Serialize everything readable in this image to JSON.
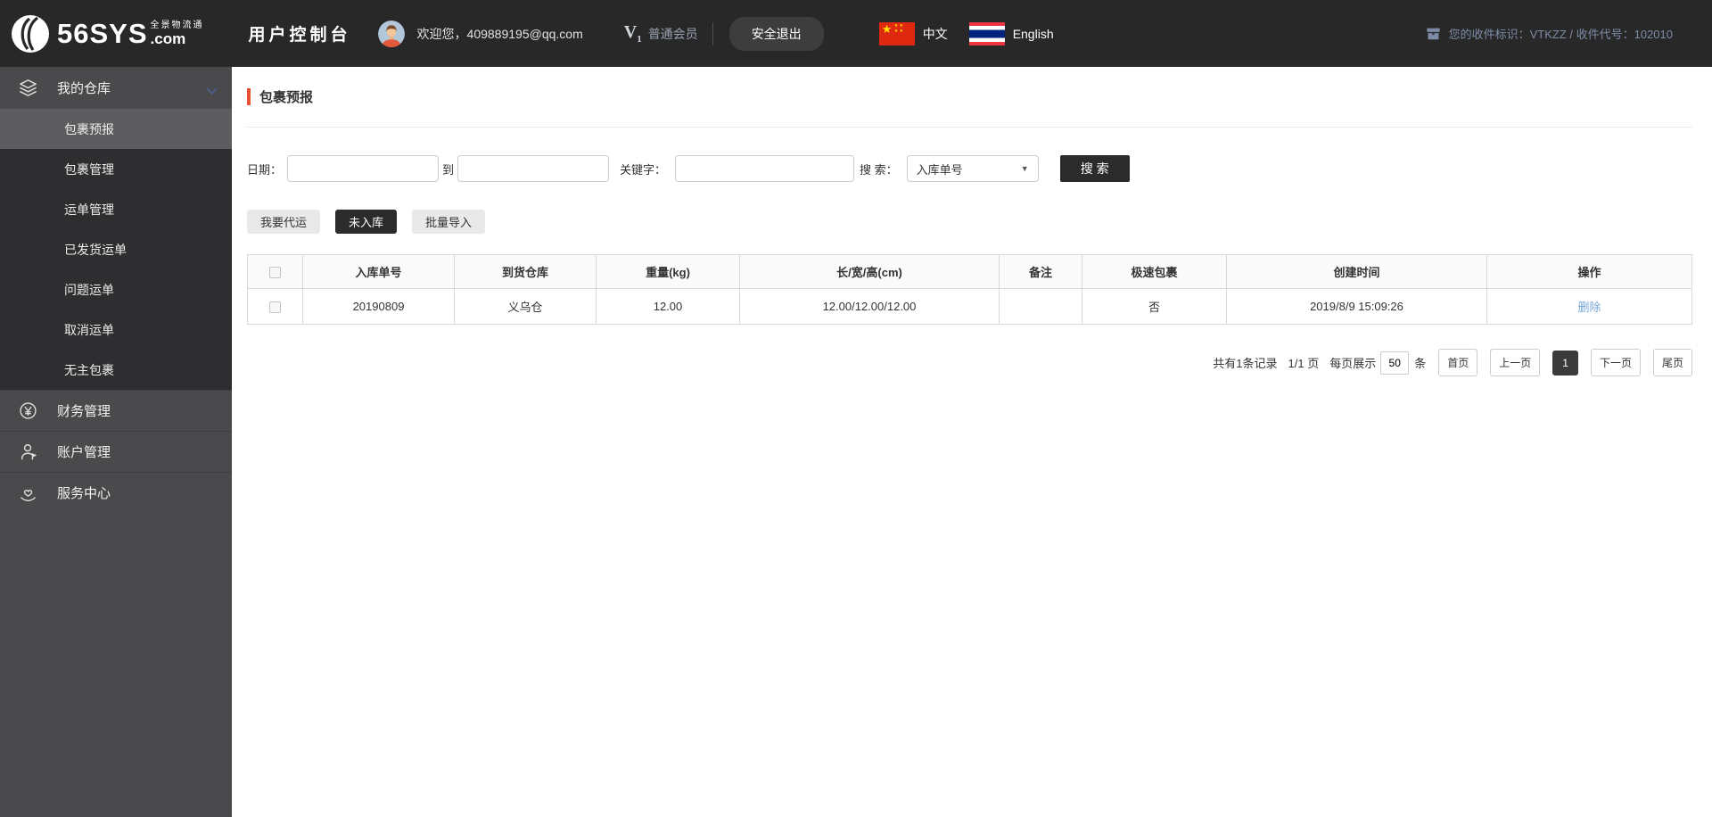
{
  "theme": {
    "header_bg": "#282828",
    "sidebar_bg": "#4a4a4c",
    "accent": "#e8502e",
    "dark_button": "#2b2b2b",
    "link_blue": "#74a7d8",
    "slate_info": "#7e8ca8"
  },
  "header": {
    "brand": "56SYS",
    "brand_domain": ".com",
    "brand_slogan": "全景物流通",
    "console_title": "用户控制台",
    "welcome_text": "欢迎您，409889195@qq.com",
    "member_level": "V",
    "member_level_sub": "1",
    "member_label": "普通会员",
    "logout_label": "安全退出",
    "lang_zh": "中文",
    "lang_en": "English",
    "receiver_info": "您的收件标识：VTKZZ / 收件代号：102010"
  },
  "sidebar": {
    "warehouse_section": "我的仓库",
    "warehouse_items": [
      {
        "label": "包裹预报",
        "active": true
      },
      {
        "label": "包裹管理",
        "active": false
      },
      {
        "label": "运单管理",
        "active": false
      },
      {
        "label": "已发货运单",
        "active": false
      },
      {
        "label": "问题运单",
        "active": false
      },
      {
        "label": "取消运单",
        "active": false
      },
      {
        "label": "无主包裹",
        "active": false
      }
    ],
    "finance_section": "财务管理",
    "account_section": "账户管理",
    "service_section": "服务中心"
  },
  "main": {
    "page_title": "包裹预报",
    "filters": {
      "date_label": "日期：",
      "to_label": "到",
      "keyword_label": "关键字：",
      "search_label": "搜 索：",
      "search_type_selected": "入库单号",
      "search_button_label": "搜 索"
    },
    "actions": {
      "consign_label": "我要代运",
      "not_in_storage_label": "未入库",
      "batch_import_label": "批量导入"
    },
    "table": {
      "headers": [
        "入库单号",
        "到货仓库",
        "重量(kg)",
        "长/宽/高(cm)",
        "备注",
        "极速包裹",
        "创建时间",
        "操作"
      ],
      "rows": [
        {
          "storage_no": "20190809",
          "warehouse": "义乌仓",
          "weight": "12.00",
          "dimensions": "12.00/12.00/12.00",
          "remark": "",
          "express": "否",
          "created_at": "2019/8/9 15:09:26",
          "action_label": "删除"
        }
      ]
    },
    "pagination": {
      "total_text": "共有1条记录",
      "page_indicator": "1/1 页",
      "per_page_label": "每页展示",
      "per_page_value": "50",
      "per_page_unit": "条",
      "first_label": "首页",
      "prev_label": "上一页",
      "current_page": "1",
      "next_label": "下一页",
      "last_label": "尾页"
    }
  }
}
